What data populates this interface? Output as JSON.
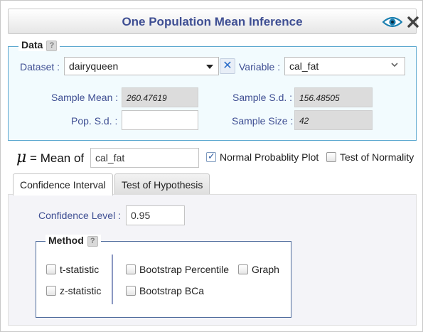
{
  "window": {
    "title": "One Population Mean Inference",
    "icons": {
      "eye": "eye-icon",
      "close": "close-x-icon"
    }
  },
  "data_section": {
    "legend": "Data",
    "help": "?",
    "dataset_label": "Dataset :",
    "dataset_value": "dairyqueen",
    "clear_symbol": "✕",
    "variable_label": "Variable :",
    "variable_value": "cal_fat",
    "sample_mean_label": "Sample Mean :",
    "sample_mean_value": "260.47619",
    "sample_sd_label": "Sample S.d. :",
    "sample_sd_value": "156.48505",
    "pop_sd_label": "Pop. S.d. :",
    "pop_sd_value": "",
    "sample_size_label": "Sample Size :",
    "sample_size_value": "42"
  },
  "mean_row": {
    "mu_symbol": "μ",
    "label": "= Mean of",
    "value": "cal_fat",
    "normal_plot_label": "Normal Probablity Plot",
    "normal_plot_checked": true,
    "normality_label": "Test of Normality",
    "normality_checked": false
  },
  "tabs": [
    {
      "label": "Confidence Interval",
      "active": true
    },
    {
      "label": "Test of Hypothesis",
      "active": false
    }
  ],
  "ci_panel": {
    "confidence_level_label": "Confidence Level :",
    "confidence_level_value": "0.95",
    "method_legend": "Method",
    "method_help": "?",
    "methods": {
      "t_statistic": "t-statistic",
      "z_statistic": "z-statistic",
      "bootstrap_percentile": "Bootstrap Percentile",
      "bootstrap_bca": "Bootstrap BCa",
      "graph": "Graph"
    }
  },
  "colors": {
    "title": "#3f4f93",
    "label": "#3f4f93",
    "fieldset_border": "#5aa7cf",
    "method_border": "#4e6b9c"
  }
}
